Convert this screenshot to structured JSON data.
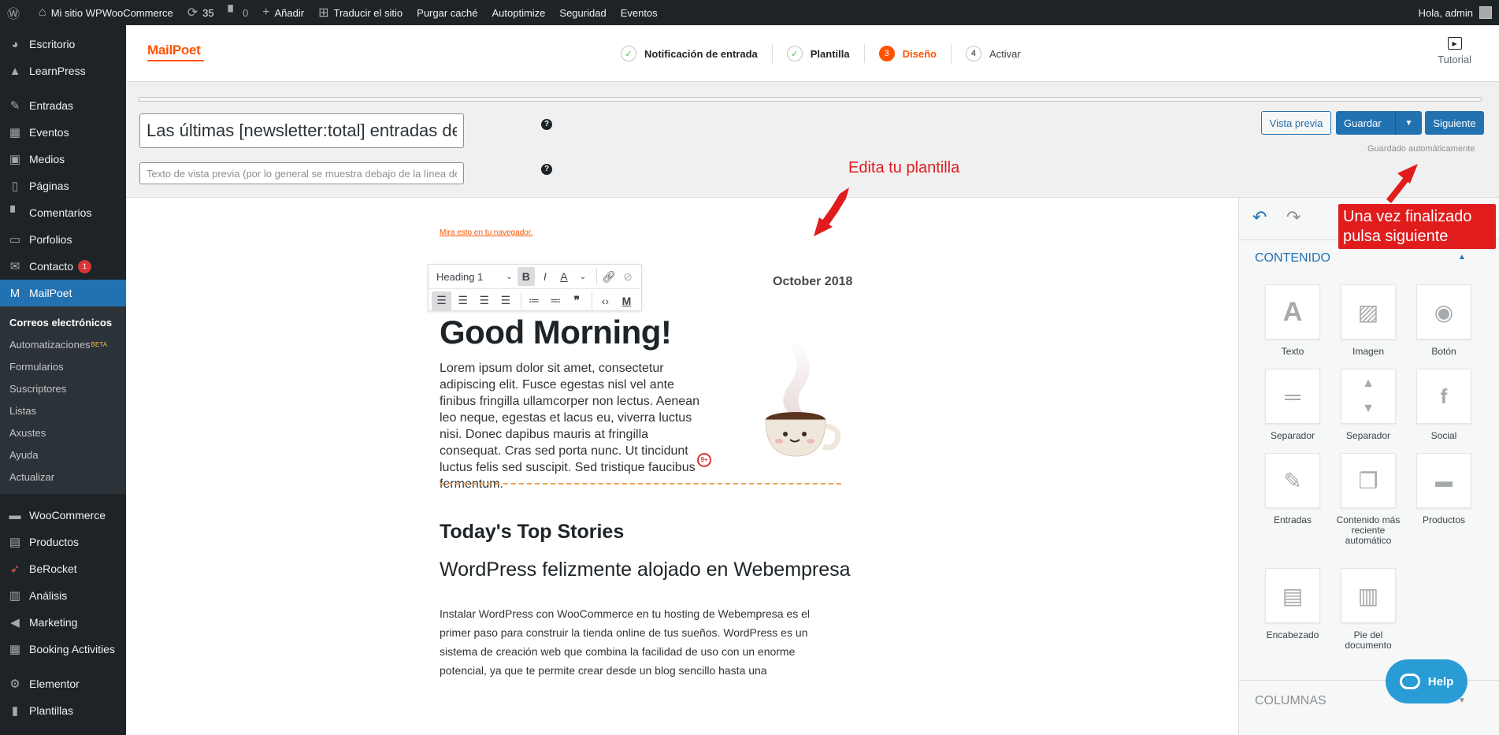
{
  "admin_bar": {
    "site_name": "Mi sitio WPWooCommerce",
    "updates_count": "35",
    "comments_count": "0",
    "add_new": "Añadir",
    "translate": "Traducir el sitio",
    "purge_cache": "Purgar caché",
    "autoptimize": "Autoptimize",
    "security": "Seguridad",
    "events": "Eventos",
    "greeting": "Hola, admin"
  },
  "sidebar": {
    "items": [
      {
        "label": "Escritorio"
      },
      {
        "label": "LearnPress"
      },
      {
        "label": "Entradas"
      },
      {
        "label": "Eventos"
      },
      {
        "label": "Medios"
      },
      {
        "label": "Páginas"
      },
      {
        "label": "Comentarios"
      },
      {
        "label": "Porfolios"
      },
      {
        "label": "Contacto",
        "badge": "1"
      },
      {
        "label": "MailPoet"
      },
      {
        "label": "WooCommerce"
      },
      {
        "label": "Productos"
      },
      {
        "label": "BeRocket"
      },
      {
        "label": "Análisis"
      },
      {
        "label": "Marketing"
      },
      {
        "label": "Booking Activities"
      },
      {
        "label": "Elementor"
      },
      {
        "label": "Plantillas"
      }
    ],
    "submenu": [
      {
        "label": "Correos electrónicos"
      },
      {
        "label": "Automatizaciones",
        "tag": "BETA"
      },
      {
        "label": "Formularios"
      },
      {
        "label": "Suscriptores"
      },
      {
        "label": "Listas"
      },
      {
        "label": "Axustes"
      },
      {
        "label": "Ayuda"
      },
      {
        "label": "Actualizar"
      }
    ]
  },
  "header": {
    "logo": "MailPoet",
    "steps": [
      {
        "num": "✓",
        "label": "Notificación de entrada"
      },
      {
        "num": "✓",
        "label": "Plantilla"
      },
      {
        "num": "3",
        "label": "Diseño"
      },
      {
        "num": "4",
        "label": "Activar"
      }
    ],
    "tutorial": "Tutorial"
  },
  "editor": {
    "subject_value": "Las últimas [newsletter:total] entradas de nuestro sitio",
    "preheader_placeholder": "Texto de vista previa (por lo general se muestra debajo de la línea de asunto en el cliente de correo)",
    "help_icon": "?",
    "preview_label": "Vista previa",
    "save_label": "Guardar",
    "next_label": "Siguiente",
    "autosave_text": "Guardado automáticamente"
  },
  "annotations": {
    "edit_template": "Edita tu plantilla",
    "press_next_1": "Una vez finalizado",
    "press_next_2": "pulsa siguiente"
  },
  "email": {
    "browser_link": "Mira esto en tu navegador.",
    "date": "October 2018",
    "toolbar_format": "Heading 1",
    "heading": "Good Morning!",
    "paragraph": "Lorem ipsum dolor sit amet, consectetur adipiscing elit. Fusce egestas nisl vel ante finibus fringilla ullamcorper non lectus. Aenean leo neque, egestas et lacus eu, viverra luctus nisi. Donec dapibus mauris at fringilla consequat. Cras sed porta nunc. Ut tincidunt luctus felis sed suscipit. Sed tristique faucibus fermentum.",
    "marker": "9+",
    "top_stories": "Today's Top Stories",
    "post_title": "WordPress felizmente alojado en Webempresa",
    "post_body": "Instalar WordPress con WooCommerce en tu hosting de Webempresa es el primer paso para construir la tienda online de tus sueños. WordPress es un sistema de creación web que combina la facilidad de uso con un enorme potencial, ya que te permite crear desde un blog sencillo hasta una"
  },
  "right_sidebar": {
    "content_heading": "CONTENIDO",
    "widgets": [
      {
        "label": "Texto"
      },
      {
        "label": "Imagen"
      },
      {
        "label": "Botón"
      },
      {
        "label": "Separador"
      },
      {
        "label": "Separador"
      },
      {
        "label": "Social"
      },
      {
        "label": "Entradas"
      },
      {
        "label": "Contenido más reciente automático"
      },
      {
        "label": "Productos"
      },
      {
        "label": "Encabezado"
      },
      {
        "label": "Pie del documento"
      }
    ],
    "columns_heading": "COLUMNAS"
  },
  "help_button": "Help",
  "colors": {
    "mailpoet_orange": "#fe5301",
    "wp_blue": "#2271b1",
    "annotation_red": "#e01c1c",
    "admin_dark": "#1d2327",
    "help_blue": "#2a9cd5"
  }
}
